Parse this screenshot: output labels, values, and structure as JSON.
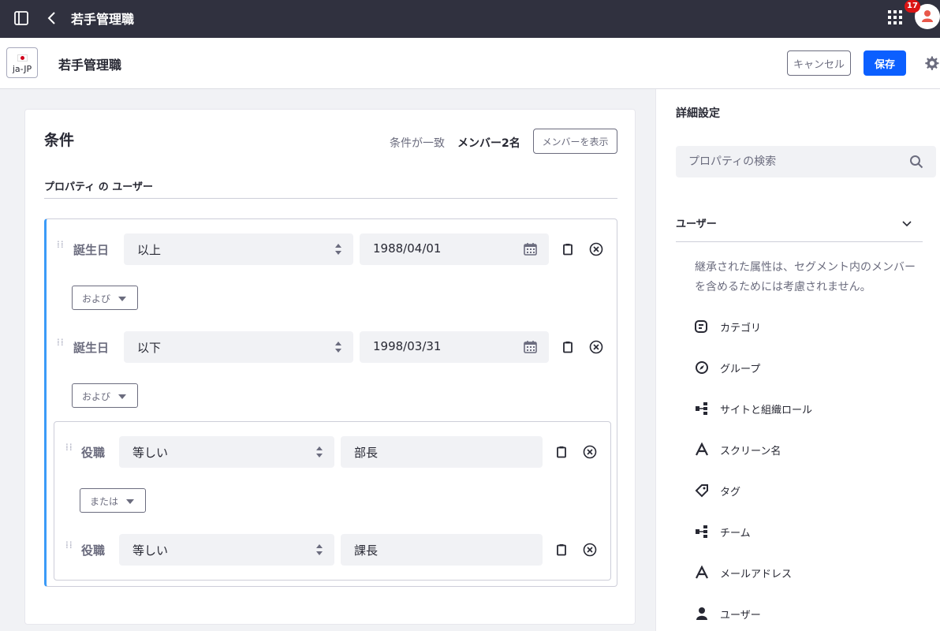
{
  "app": {
    "title": "若手管理職",
    "notification_count": "17"
  },
  "header": {
    "language_code": "ja-JP",
    "title": "若手管理職",
    "cancel_label": "キャンセル",
    "save_label": "保存"
  },
  "criteria": {
    "title": "条件",
    "match_label": "条件が一致",
    "member_count": "メンバー2名",
    "view_members_label": "メンバーを表示",
    "property_heading": "プロパティ の ユーザー",
    "rows": [
      {
        "property": "誕生日",
        "operator": "以上",
        "value": "1988/04/01"
      },
      {
        "property": "誕生日",
        "operator": "以下",
        "value": "1998/03/31"
      },
      {
        "property": "役職",
        "operator": "等しい",
        "value": "部長"
      },
      {
        "property": "役職",
        "operator": "等しい",
        "value": "課長"
      }
    ],
    "conjunctions": [
      "および",
      "および",
      "または"
    ]
  },
  "sidebar": {
    "title": "詳細設定",
    "search_placeholder": "プロパティの検索",
    "category": "ユーザー",
    "note": "継承された属性は、セグメント内のメンバーを含めるためには考慮されません。",
    "items": [
      {
        "label": "カテゴリ",
        "icon": "categories-icon"
      },
      {
        "label": "グループ",
        "icon": "compass-icon"
      },
      {
        "label": "サイトと組織ロール",
        "icon": "hierarchy-icon"
      },
      {
        "label": "スクリーン名",
        "icon": "text-icon"
      },
      {
        "label": "タグ",
        "icon": "tag-icon"
      },
      {
        "label": "チーム",
        "icon": "hierarchy-icon"
      },
      {
        "label": "メールアドレス",
        "icon": "text-icon"
      },
      {
        "label": "ユーザー",
        "icon": "user-icon"
      }
    ]
  }
}
